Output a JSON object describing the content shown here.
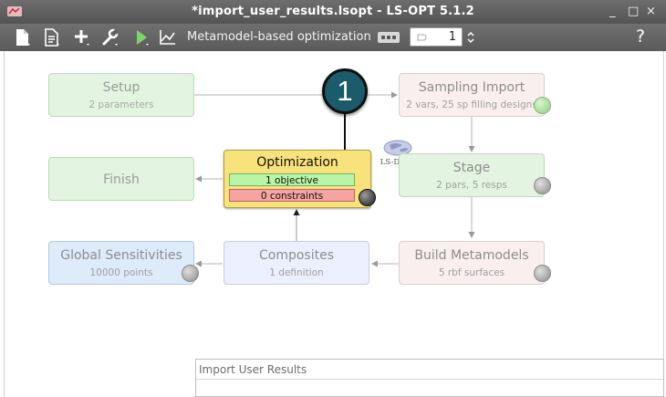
{
  "window": {
    "title": "*import_user_results.lsopt - LS-OPT 5.1.2",
    "minimize": "_",
    "maximize": "□",
    "close": "×"
  },
  "toolbar": {
    "mode_label": "Metamodel-based optimization",
    "iteration_value": "1",
    "help_label": "?",
    "icons": [
      "new-file-icon",
      "file-list-icon",
      "add-icon",
      "wrench-icon",
      "run-icon",
      "chart-icon"
    ]
  },
  "nodes": {
    "setup": {
      "title": "Setup",
      "sub": "2 parameters"
    },
    "sampling": {
      "title": "Sampling Import",
      "sub": "2 vars, 25 sp filling designs"
    },
    "stage": {
      "title": "Stage",
      "sub": "2 pars, 5 resps",
      "solver_logo": "LS-DYNA"
    },
    "optimization": {
      "title": "Optimization",
      "objective": "1 objective",
      "constraints": "0 constraints"
    },
    "finish": {
      "title": "Finish"
    },
    "global": {
      "title": "Global Sensitivities",
      "sub": "10000 points"
    },
    "composites": {
      "title": "Composites",
      "sub": "1 definition"
    },
    "build": {
      "title": "Build Metamodels",
      "sub": "5 rbf surfaces"
    }
  },
  "callout": {
    "number": "1"
  },
  "panel": {
    "label": "Import User Results"
  },
  "colors": {
    "title_bar": "#5e5e5e",
    "green_node_bg": "#e3f5e1",
    "pink_node_bg": "#f9efef",
    "blue_node_bg": "#ddebfa",
    "lavender_node_bg": "#eceffd",
    "optimization_bg": "#f8e27c",
    "objective_pill": "#b8f5a8",
    "constraints_pill": "#f5a3a3",
    "callout_bg": "#1c5b6b"
  }
}
